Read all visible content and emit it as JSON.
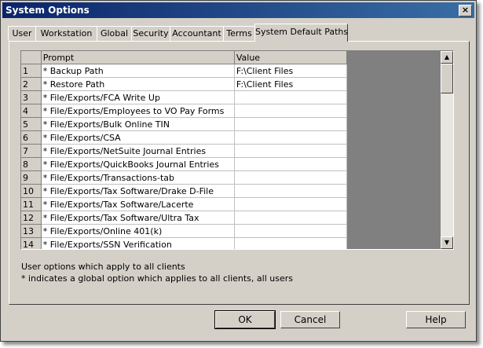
{
  "window": {
    "title": "System Options"
  },
  "tabs": [
    {
      "label": "User"
    },
    {
      "label": "Workstation"
    },
    {
      "label": "Global"
    },
    {
      "label": "Security"
    },
    {
      "label": "Accountant"
    },
    {
      "label": "Terms"
    },
    {
      "label": "System Default Paths",
      "active": true
    }
  ],
  "grid": {
    "columns": [
      "",
      "Prompt",
      "Value"
    ],
    "rows": [
      {
        "num": "1",
        "prompt": "* Backup Path",
        "value": "F:\\Client Files"
      },
      {
        "num": "2",
        "prompt": "* Restore Path",
        "value": "F:\\Client Files"
      },
      {
        "num": "3",
        "prompt": "* File/Exports/FCA Write Up",
        "value": ""
      },
      {
        "num": "4",
        "prompt": "* File/Exports/Employees to VO Pay Forms",
        "value": ""
      },
      {
        "num": "5",
        "prompt": "* File/Exports/Bulk Online TIN",
        "value": ""
      },
      {
        "num": "6",
        "prompt": "* File/Exports/CSA",
        "value": ""
      },
      {
        "num": "7",
        "prompt": "* File/Exports/NetSuite Journal Entries",
        "value": ""
      },
      {
        "num": "8",
        "prompt": "* File/Exports/QuickBooks Journal Entries",
        "value": ""
      },
      {
        "num": "9",
        "prompt": "* File/Exports/Transactions-tab",
        "value": ""
      },
      {
        "num": "10",
        "prompt": "* File/Exports/Tax Software/Drake D-File",
        "value": ""
      },
      {
        "num": "11",
        "prompt": "* File/Exports/Tax Software/Lacerte",
        "value": ""
      },
      {
        "num": "12",
        "prompt": "* File/Exports/Tax Software/Ultra Tax",
        "value": ""
      },
      {
        "num": "13",
        "prompt": "* File/Exports/Online 401(k)",
        "value": ""
      },
      {
        "num": "14",
        "prompt": "* File/Exports/SSN Verification",
        "value": ""
      }
    ]
  },
  "notes": {
    "line1": "User options which apply to all clients",
    "line2": "* indicates a global option which applies to all clients, all users"
  },
  "buttons": {
    "ok": "OK",
    "cancel": "Cancel",
    "help": "Help"
  },
  "icons": {
    "close": "×",
    "scroll_up": "▲",
    "scroll_down": "▼"
  }
}
